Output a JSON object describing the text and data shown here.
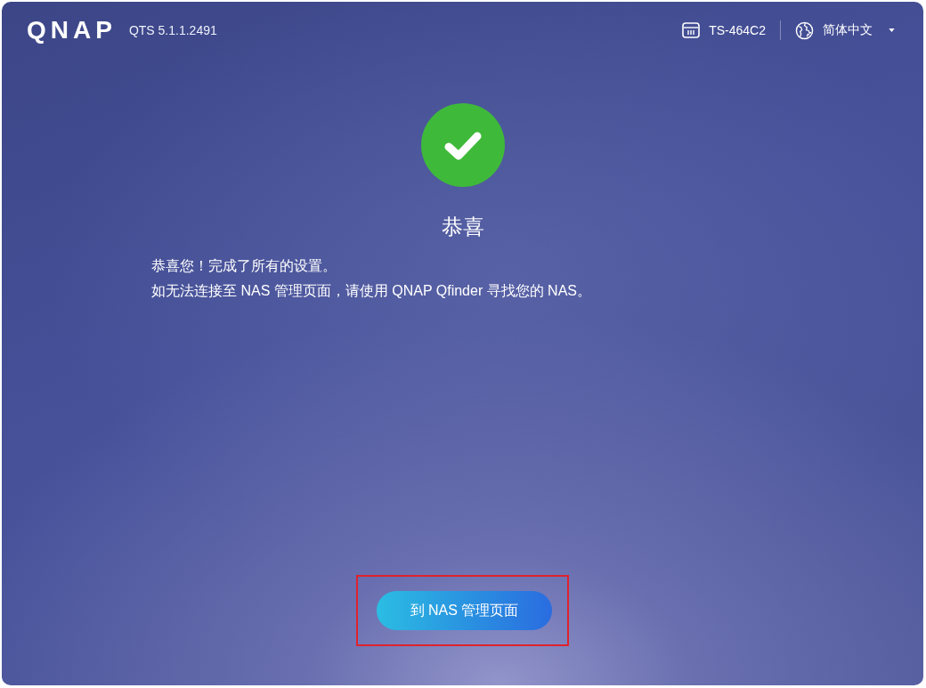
{
  "header": {
    "logo": "QNAP",
    "version": "QTS 5.1.1.2491",
    "device": "TS-464C2",
    "language": "简体中文"
  },
  "status": {
    "kind": "success",
    "title": "恭喜"
  },
  "messages": [
    "恭喜您！完成了所有的设置。",
    "如无法连接至 NAS 管理页面，请使用 QNAP Qfinder 寻找您的 NAS。"
  ],
  "button": {
    "label": "到 NAS 管理页面",
    "highlighted": true
  }
}
